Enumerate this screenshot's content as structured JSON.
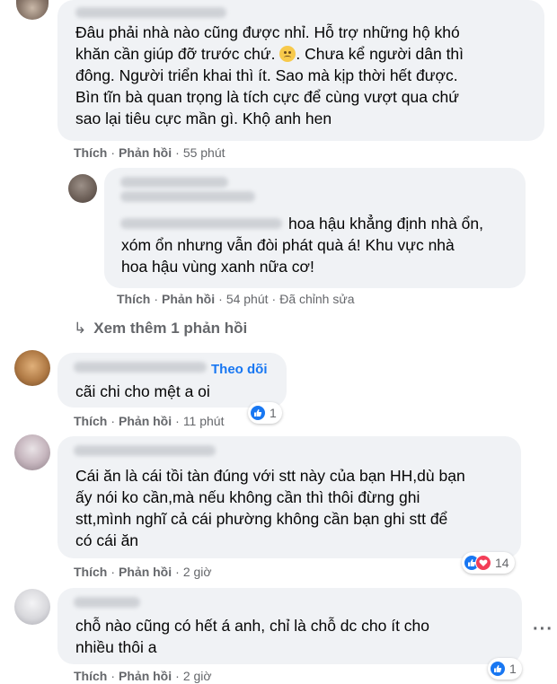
{
  "actions": {
    "like": "Thích",
    "reply": "Phản hồi",
    "sep": "·"
  },
  "see_more": {
    "arrow": "↳",
    "label": "Xem thêm 1 phản hồi"
  },
  "follow_label": "Theo dõi",
  "comments": [
    {
      "lines": [
        "Đâu phải nhà nào cũng được nhỉ. Hỗ trợ những hộ khó",
        "khăn cần giúp đỡ trước chứ.",
        "Chưa kể người dân thì",
        "đông. Người triển khai thì ít. Sao mà kịp thời hết được.",
        "Bìn tĩn bà quan trọng là tích cực để cùng vượt qua chứ",
        "sao lại tiêu cực mần gì. Khộ anh hen"
      ],
      "time": "55 phút"
    },
    {
      "lines": [
        "hoa hậu khẳng định nhà ổn,",
        "xóm ổn nhưng vẫn đòi phát quà á! Khu vực nhà",
        "hoa hậu vùng xanh nữa cơ!"
      ],
      "time": "54 phút",
      "edited": "Đã chỉnh sửa"
    },
    {
      "lines": [
        "cãi chi cho mệt a oi"
      ],
      "time": "11 phút",
      "reactions": "1"
    },
    {
      "lines": [
        "Cái ăn là cái tồi tàn đúng với stt này của bạn HH,dù bạn",
        "ấy nói ko cần,mà nếu không cần thì thôi đừng ghi",
        "stt,mình nghĩ cả cái phường không cần bạn ghi stt để",
        "có cái ăn"
      ],
      "time": "2 giờ",
      "reactions": "14"
    },
    {
      "lines": [
        "chỗ nào cũng có hết á anh, chỉ là chỗ dc cho ít cho",
        "nhiều thôi a"
      ],
      "time": "2 giờ",
      "reactions": "1"
    }
  ],
  "more_label": "···"
}
